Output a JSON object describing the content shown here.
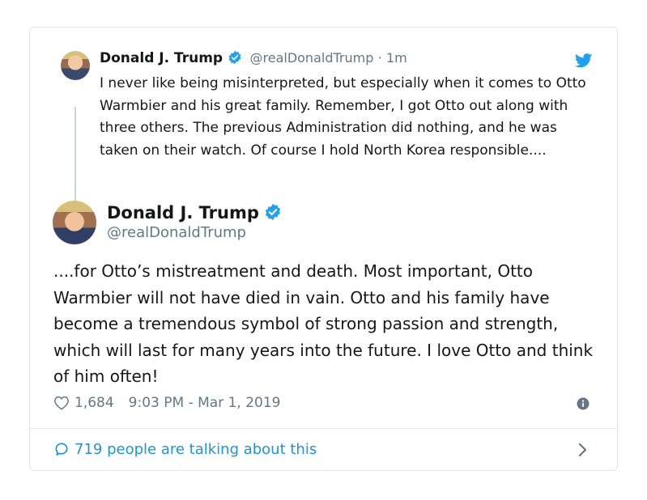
{
  "parent_tweet": {
    "name": "Donald J. Trump",
    "handle": "@realDonaldTrump",
    "time": "· 1m",
    "text": "I never like being misinterpreted, but especially when it comes to Otto Warmbier and his great family. Remember, I got Otto out along with three others. The previous Administration did nothing, and he was taken on their watch. Of course I hold North Korea responsible...."
  },
  "main_tweet": {
    "name": "Donald J. Trump",
    "handle": "@realDonaldTrump",
    "text": "....for Otto’s mistreatment and death. Most important, Otto Warmbier will not have died in vain. Otto and his family have become a tremendous symbol of strong passion and strength, which will last for many years into the future. I love Otto and think of him often!",
    "likes": "1,684",
    "timestamp": "9:03 PM - Mar 1, 2019"
  },
  "footer": {
    "talking_label": "719 people are talking about this"
  },
  "icons": {
    "verified": "verified-badge-icon",
    "bird": "twitter-bird-icon",
    "heart": "heart-icon",
    "info": "info-icon",
    "bubble": "speech-bubble-icon",
    "chevron": "chevron-right-icon"
  },
  "colors": {
    "brand_blue": "#1da1f2",
    "link_blue": "#1b95e0",
    "muted": "#657786",
    "text": "#14171a",
    "border": "#e1e8ed"
  }
}
